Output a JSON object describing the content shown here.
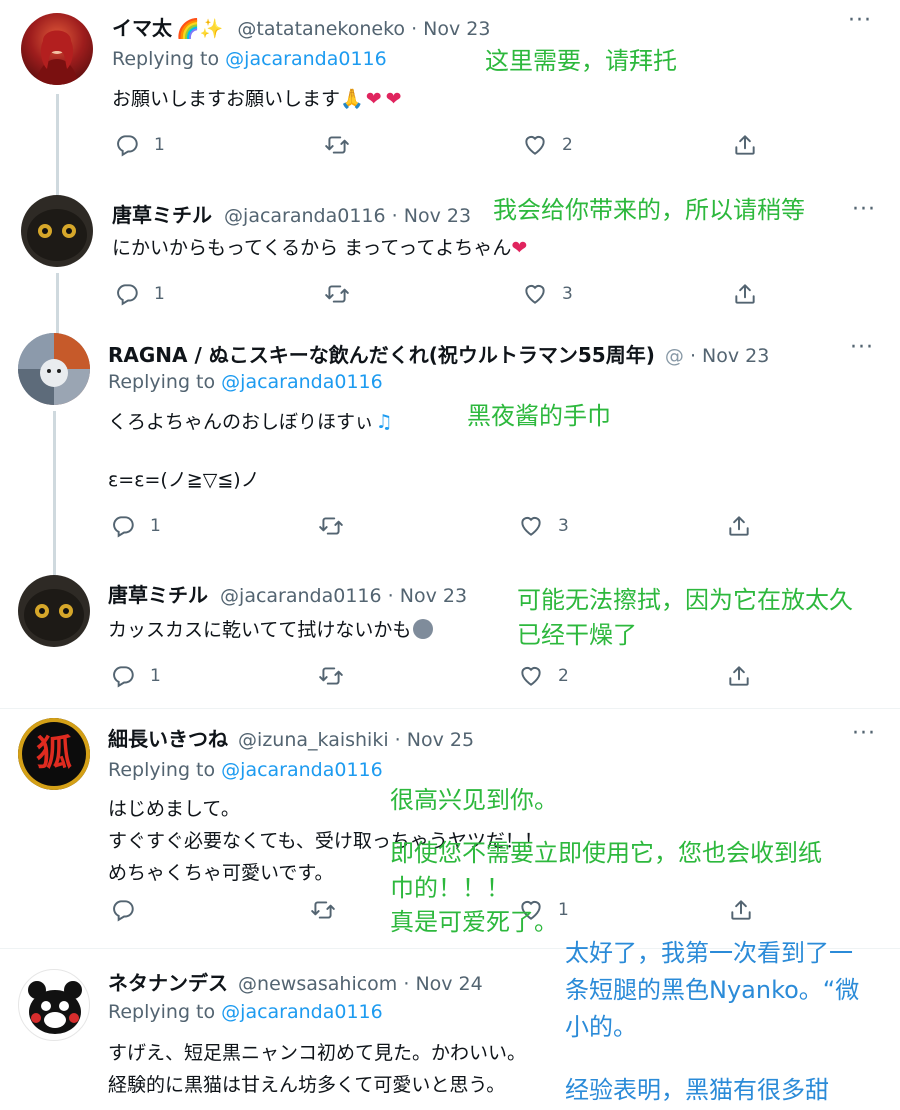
{
  "tweets": [
    {
      "name": "イマ太",
      "handle": "@tatatanekoneko",
      "date": "· Nov 23",
      "replying_label": "Replying to",
      "replying_handle": "@jacaranda0116",
      "lines": [
        "お願いしますお願いします"
      ],
      "replies": "1",
      "retweets": "",
      "likes": "2",
      "note": [
        "这里需要，请拜托"
      ]
    },
    {
      "name": "唐草ミチル",
      "handle": "@jacaranda0116",
      "date": "· Nov 23",
      "lines": [
        "にかいからもってくるから まってってよちゃん"
      ],
      "replies": "1",
      "retweets": "",
      "likes": "3",
      "note": [
        "我会给你带来的，所以请稍等"
      ]
    },
    {
      "name": "RAGNA / ぬこスキーな飲んだくれ(祝ウルトラマン55周年)",
      "handle": "@",
      "date": "· Nov 23",
      "replying_label": "Replying to",
      "replying_handle": "@jacaranda0116",
      "lines": [
        "くろよちゃんのおしぼりほすぃ",
        "ε=ε=(ノ≧▽≦)ノ"
      ],
      "replies": "1",
      "retweets": "",
      "likes": "3",
      "note": [
        "黑夜酱的手巾"
      ]
    },
    {
      "name": "唐草ミチル",
      "handle": "@jacaranda0116",
      "date": "· Nov 23",
      "lines": [
        "カッスカスに乾いてて拭けないかも"
      ],
      "replies": "1",
      "retweets": "",
      "likes": "2",
      "note": [
        "可能无法擦拭，因为它在放太久",
        "已经干燥了"
      ]
    },
    {
      "name": "細長いきつね",
      "handle": "@izuna_kaishiki",
      "date": "· Nov 25",
      "replying_label": "Replying to",
      "replying_handle": "@jacaranda0116",
      "lines": [
        "はじめまして。",
        "すぐすぐ必要なくても、受け取っちゃうヤツだ！！",
        "めちゃくちゃ可愛いです。"
      ],
      "replies": "",
      "retweets": "",
      "likes": "1",
      "note": [
        "很高兴见到你。",
        "即使您不需要立即使用它，您也会收到纸",
        "巾的！！！",
        "真是可爱死了。"
      ],
      "avatar_text": "狐"
    },
    {
      "name": "ネタナンデス",
      "handle": "@newsasahicom",
      "date": "· Nov 24",
      "replying_label": "Replying to",
      "replying_handle": "@jacaranda0116",
      "lines": [
        "すげえ、短足黒ニャンコ初めて見た。かわいい。",
        "経験的に黒猫は甘えん坊多くて可愛いと思う。"
      ],
      "note": [
        "太好了，我第一次看到了一",
        "条短腿的黑色Nyanko。“微",
        "小的。",
        "经验表明，黑猫有很多甜"
      ]
    }
  ],
  "more_label": "···",
  "colors": {
    "link": "#1d9bf0",
    "note_green": "#2db83d",
    "note_blue": "#2b8bd8",
    "muted": "#536471"
  }
}
